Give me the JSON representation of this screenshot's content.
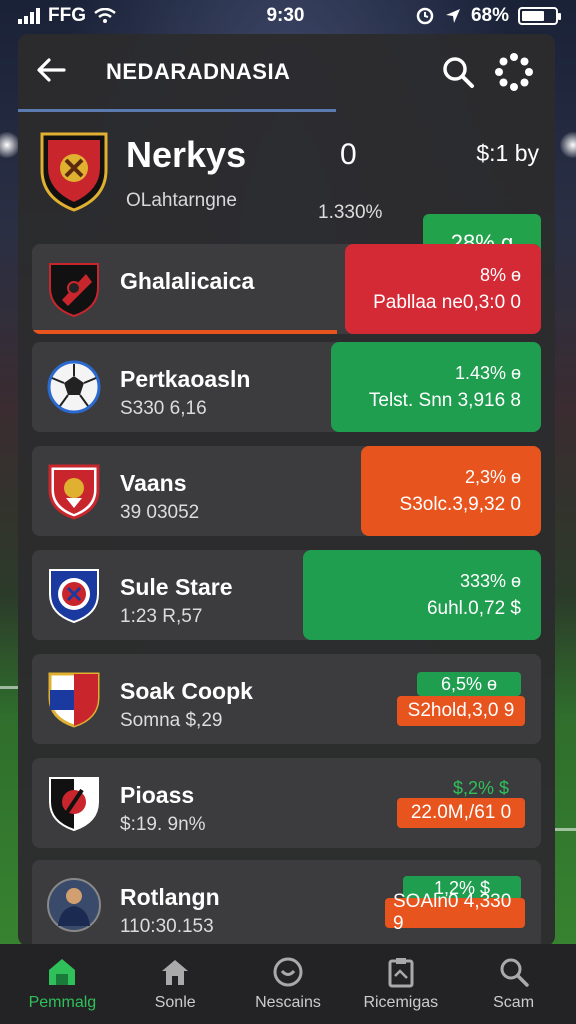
{
  "status_bar": {
    "carrier": "FFG",
    "time": "9:30",
    "battery": "68%",
    "battery_level": 0.68
  },
  "header": {
    "title": "NEDARADNASIA"
  },
  "featured": {
    "name": "Nerkys",
    "subtitle": "OLahtarngne",
    "score": "0",
    "percent": "1.330%",
    "price": "$:1 by",
    "button": "28% g"
  },
  "rows": [
    {
      "name": "Ghalalicaica",
      "sub": "",
      "pct": "8% ɵ",
      "amt": "Pabllaa ne0,3:0 0",
      "color": "#d32a36",
      "bar_fraction": 0.6
    },
    {
      "name": "Pertkaoasln",
      "sub": "S330 6,16",
      "pct": "1.43% ɵ",
      "amt": "Telst. Snn 3,916 8",
      "color": "#1f9e50"
    },
    {
      "name": "Vaans",
      "sub": "39 03052",
      "pct": "2,3% ɵ",
      "amt": "S3olc.3,9,32 0",
      "color": "#e8541e"
    },
    {
      "name": "Sule Stare",
      "sub": "1:23 R,57",
      "pct": "333% ɵ",
      "amt": "6uhl.0,72 $",
      "color": "#1f9e50"
    },
    {
      "name": "Soak Coopk",
      "sub": "Somna $,29",
      "pct": "6,5% ɵ",
      "amt": "S2hold,3,0 9",
      "pct_color": "#1f9e50",
      "amt_color": "#e8541e"
    },
    {
      "name": "Pioass",
      "sub": "$:19. 9n%",
      "pct": "$,2% $",
      "amt": "22.0M,/61 0",
      "pct_color": "#1f9e50",
      "amt_color": "#e8541e"
    },
    {
      "name": "Rotlangn",
      "sub": "110:30.153",
      "pct": "1,2% $",
      "amt": "SOAln0 4,330 9",
      "pct_color": "#1f9e50",
      "amt_color": "#e8541e"
    }
  ],
  "nav": [
    {
      "label": "Pemmalg",
      "icon": "home-icon",
      "active": true
    },
    {
      "label": "Sonle",
      "icon": "house-icon"
    },
    {
      "label": "Nescains",
      "icon": "circle-icon"
    },
    {
      "label": "Ricemigas",
      "icon": "clipboard-icon"
    },
    {
      "label": "Scam",
      "icon": "search-icon"
    }
  ],
  "colors": {
    "accent_green": "#22a24a",
    "accent_red": "#d32a36",
    "accent_orange": "#e8541e",
    "panel": "#2c2c2e"
  }
}
